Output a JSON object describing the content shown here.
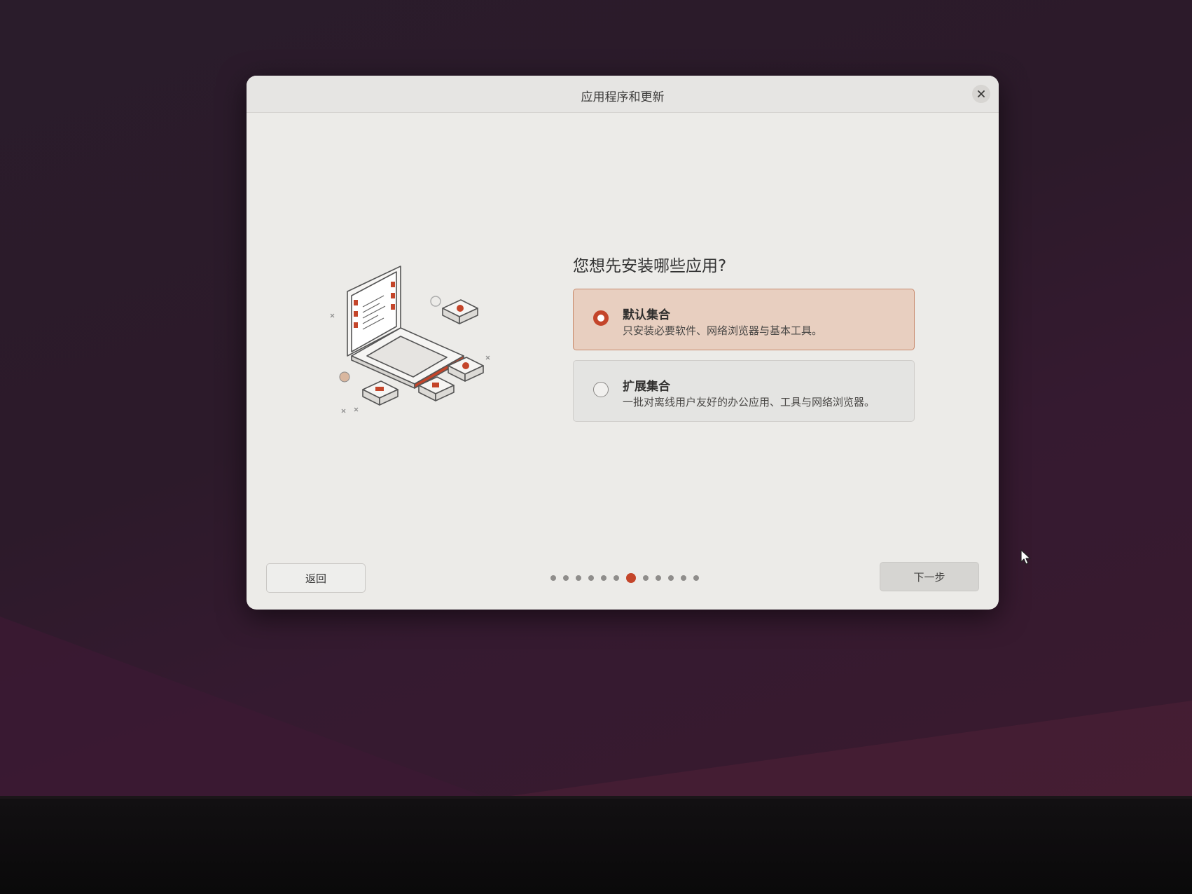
{
  "dialog": {
    "title": "应用程序和更新",
    "question": "您想先安装哪些应用?",
    "options": [
      {
        "title": "默认集合",
        "description": "只安装必要软件、网络浏览器与基本工具。",
        "selected": true
      },
      {
        "title": "扩展集合",
        "description": "一批对离线用户友好的办公应用、工具与网络浏览器。",
        "selected": false
      }
    ],
    "back_label": "返回",
    "next_label": "下一步",
    "progress": {
      "total_steps": 12,
      "current_step": 7
    }
  },
  "colors": {
    "accent": "#c4452a",
    "selected_option_bg": "#e8cfc0",
    "dialog_bg": "#ecebe8"
  },
  "icons": [
    "close-icon",
    "laptop-illustration",
    "radio-selected",
    "radio-unselected",
    "mouse-pointer-icon"
  ]
}
